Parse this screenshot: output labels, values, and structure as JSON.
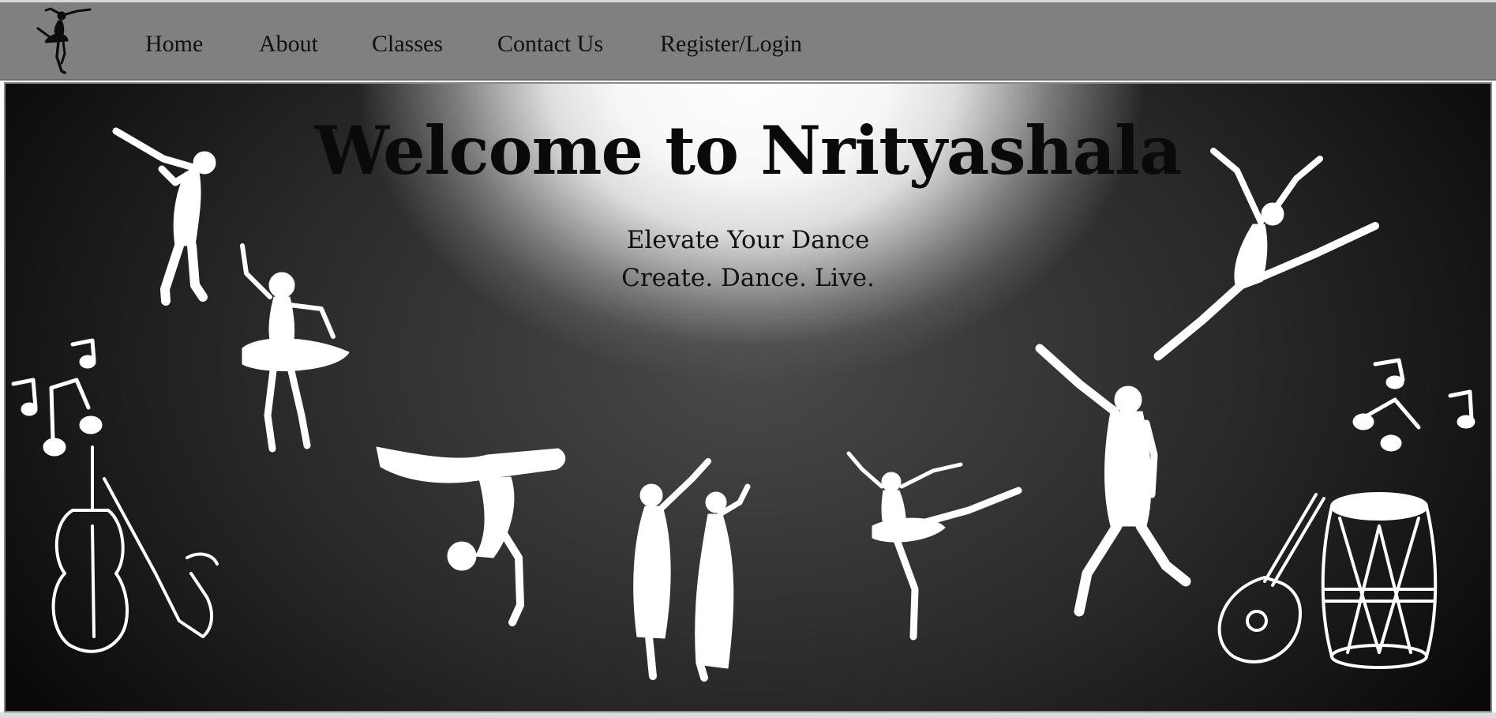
{
  "navbar": {
    "logo_icon": "ballerina-logo-icon",
    "links": [
      {
        "label": "Home"
      },
      {
        "label": "About"
      },
      {
        "label": "Classes"
      },
      {
        "label": "Contact Us"
      },
      {
        "label": "Register/Login"
      }
    ],
    "background": "#808080"
  },
  "hero": {
    "title": "Welcome to Nrityashala",
    "tagline_1": "Elevate Your Dance",
    "tagline_2": "Create. Dance. Live.",
    "illustration_icons": [
      "dabbing-dancer-icon",
      "ballerina-tutu-icon",
      "breakdancer-icon",
      "couple-dancers-icon",
      "arabesque-ballerina-icon",
      "jumping-dancer-icon",
      "leaping-dancer-icon",
      "music-notes-icon",
      "violin-saxophone-icon",
      "sitar-icon",
      "dhol-drum-icon"
    ],
    "colors": {
      "spotlight": "#ffffff",
      "background": "#1a1a1a",
      "silhouette": "#ffffff"
    }
  }
}
